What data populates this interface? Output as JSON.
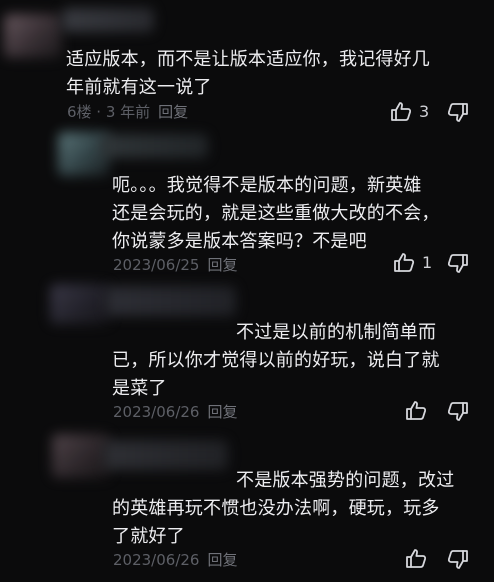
{
  "comments": [
    {
      "lines": [
        "适应版本，而不是让版本适应你，我记得好几",
        "年前就有这一说了"
      ],
      "meta": "6楼 · 3 年前",
      "reply_label": "回复",
      "like_count": "3",
      "dislike_count": ""
    },
    {
      "lines": [
        "呃。。。我觉得不是版本的问题，新英雄",
        "还是会玩的，就是这些重做大改的不会，",
        "你说蒙多是版本答案吗？不是吧"
      ],
      "meta": "2023/06/25",
      "reply_label": "回复",
      "like_count": "1",
      "dislike_count": ""
    },
    {
      "lines": [
        "不过是以前的机制简单而",
        "已，所以你才觉得以前的好玩，说白了就",
        "是菜了"
      ],
      "meta": "2023/06/26",
      "reply_label": "回复",
      "like_count": "",
      "dislike_count": ""
    },
    {
      "lines": [
        "不是版本强势的问题，改过",
        "的英雄再玩不惯也没办法啊，硬玩，玩多",
        "了就好了"
      ],
      "meta": "2023/06/26",
      "reply_label": "回复",
      "like_count": "",
      "dislike_count": ""
    }
  ],
  "icons": {
    "like": "thumbs-up-icon",
    "dislike": "thumbs-down-icon"
  },
  "colors": {
    "background": "#0b0b0c",
    "text": "#ededf0",
    "meta": "#5d5f66"
  }
}
